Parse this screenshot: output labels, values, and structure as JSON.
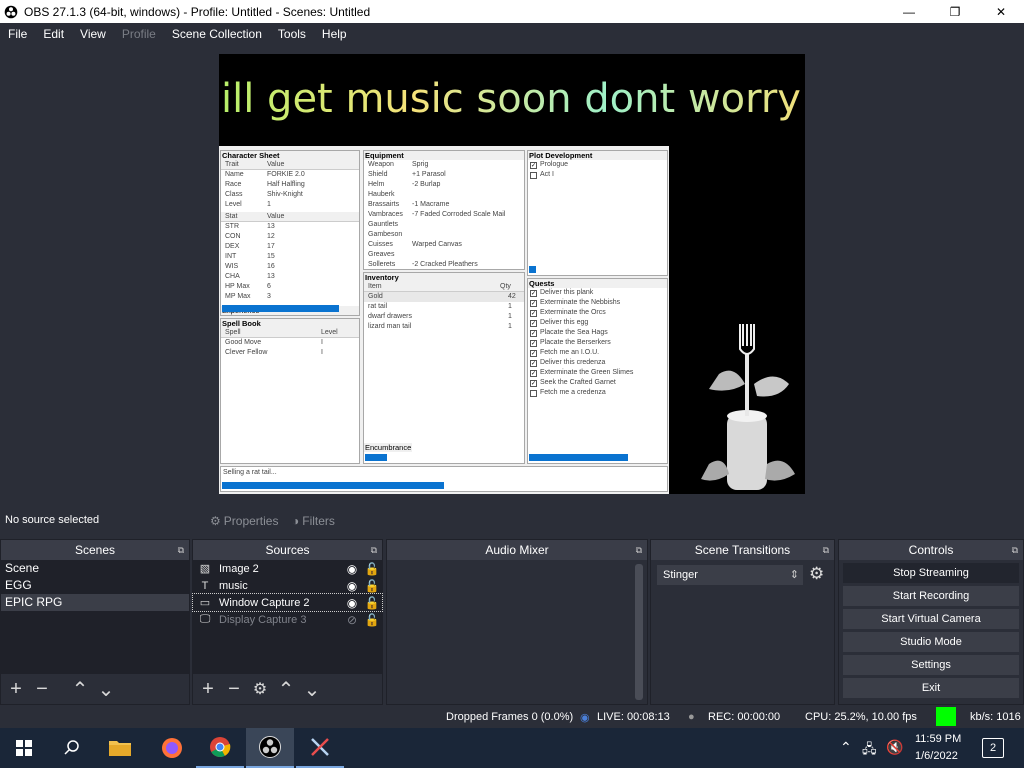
{
  "window": {
    "title": "OBS 27.1.3 (64-bit, windows) - Profile: Untitled - Scenes: Untitled",
    "minimize": "—",
    "maximize": "❐",
    "close": "✕"
  },
  "menu": [
    "File",
    "Edit",
    "View",
    "Profile",
    "Scene Collection",
    "Tools",
    "Help"
  ],
  "preview": {
    "banner_text": "ill get music soon dont worry",
    "game": {
      "character_sheet": {
        "title": "Character Sheet",
        "trait_header": [
          "Trait",
          "Value"
        ],
        "traits": [
          [
            "Name",
            "FORKIE 2.0"
          ],
          [
            "Race",
            "Half Halfling"
          ],
          [
            "Class",
            "Shiv-Knight"
          ],
          [
            "Level",
            "1"
          ]
        ],
        "stat_header": [
          "Stat",
          "Value"
        ],
        "stats": [
          [
            "STR",
            "13"
          ],
          [
            "CON",
            "12"
          ],
          [
            "DEX",
            "17"
          ],
          [
            "INT",
            "15"
          ],
          [
            "WIS",
            "16"
          ],
          [
            "CHA",
            "13"
          ],
          [
            "HP Max",
            "6"
          ],
          [
            "MP Max",
            "3"
          ]
        ],
        "experience_label": "Experience",
        "experience_progress": 0.86
      },
      "spell_book": {
        "title": "Spell Book",
        "header": [
          "Spell",
          "Level"
        ],
        "spells": [
          [
            "Good Move",
            "I"
          ],
          [
            "Clever Fellow",
            "I"
          ]
        ]
      },
      "equipment": {
        "title": "Equipment",
        "items": [
          [
            "Weapon",
            "Sprig"
          ],
          [
            "Shield",
            "+1 Parasol"
          ],
          [
            "Helm",
            "-2 Burlap"
          ],
          [
            "Hauberk",
            ""
          ],
          [
            "Brassairts",
            "-1 Macrame"
          ],
          [
            "Vambraces",
            "-7 Faded Corroded Scale Mail"
          ],
          [
            "Gauntlets",
            ""
          ],
          [
            "Gambeson",
            ""
          ],
          [
            "Cuisses",
            "Warped Canvas"
          ],
          [
            "Greaves",
            ""
          ],
          [
            "Sollerets",
            "-2 Cracked Pleathers"
          ]
        ]
      },
      "inventory": {
        "title": "Inventory",
        "header": [
          "Item",
          "Qty"
        ],
        "items": [
          [
            "Gold",
            "42"
          ],
          [
            "rat tail",
            "1"
          ],
          [
            "dwarf drawers",
            "1"
          ],
          [
            "lizard man tail",
            "1"
          ]
        ],
        "encumbrance_label": "Encumbrance",
        "encumbrance_progress": 0.14
      },
      "plot": {
        "title": "Plot Development",
        "items": [
          {
            "label": "Prologue",
            "checked": true
          },
          {
            "label": "Act I",
            "checked": false
          }
        ],
        "progress": 0.05
      },
      "quests": {
        "title": "Quests",
        "items": [
          {
            "label": "Deliver this plank",
            "checked": true
          },
          {
            "label": "Exterminate the Nebbishs",
            "checked": true
          },
          {
            "label": "Exterminate the Orcs",
            "checked": true
          },
          {
            "label": "Deliver this egg",
            "checked": true
          },
          {
            "label": "Placate the Sea Hags",
            "checked": true
          },
          {
            "label": "Placate the Berserkers",
            "checked": true
          },
          {
            "label": "Fetch me an I.O.U.",
            "checked": true
          },
          {
            "label": "Deliver this credenza",
            "checked": true
          },
          {
            "label": "Exterminate the Green Slimes",
            "checked": true
          },
          {
            "label": "Seek the Crafted Garnet",
            "checked": true
          },
          {
            "label": "Fetch me a credenza",
            "checked": false
          }
        ],
        "progress": 0.72
      },
      "status_text": "Selling a rat tail...",
      "status_progress": 0.5
    }
  },
  "source_toolbar": {
    "no_source": "No source selected",
    "properties": "Properties",
    "filters": "Filters"
  },
  "scenes": {
    "title": "Scenes",
    "items": [
      "Scene",
      "EGG",
      "EPIC RPG"
    ],
    "selected": "EPIC RPG"
  },
  "sources": {
    "title": "Sources",
    "items": [
      {
        "name": "Image 2",
        "icon": "image-icon",
        "visible": true
      },
      {
        "name": "music",
        "icon": "text-icon",
        "visible": true
      },
      {
        "name": "Window Capture 2",
        "icon": "window-icon",
        "visible": true
      },
      {
        "name": "Display Capture 3",
        "icon": "monitor-icon",
        "visible": false
      }
    ]
  },
  "audio_mixer": {
    "title": "Audio Mixer"
  },
  "scene_transitions": {
    "title": "Scene Transitions",
    "selected": "Stinger"
  },
  "controls": {
    "title": "Controls",
    "buttons": [
      "Stop Streaming",
      "Start Recording",
      "Start Virtual Camera",
      "Studio Mode",
      "Settings",
      "Exit"
    ]
  },
  "statusbar": {
    "dropped_frames": "Dropped Frames 0 (0.0%)",
    "live": "LIVE: 00:08:13",
    "rec": "REC: 00:00:00",
    "cpu": "CPU: 25.2%, 10.00 fps",
    "kbps": "kb/s: 1016",
    "health_color": "#00ff00"
  },
  "taskbar": {
    "time": "11:59 PM",
    "date": "1/6/2022",
    "notification_count": "2"
  }
}
